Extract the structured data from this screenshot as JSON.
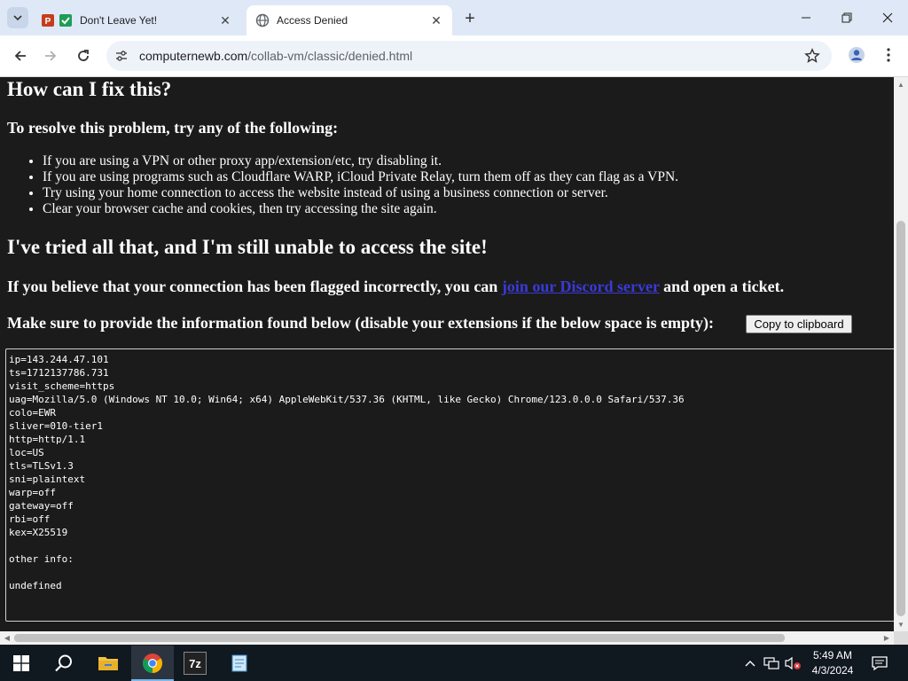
{
  "tabs": [
    {
      "title": "Don't Leave Yet!",
      "close": "✕"
    },
    {
      "title": "Access Denied",
      "close": "✕"
    }
  ],
  "new_tab": "+",
  "window_controls": {
    "minimize": "—",
    "maximize": "❐",
    "close": "✕"
  },
  "omnibox": {
    "host": "computernewb.com",
    "path": "/collab-vm/classic/denied.html"
  },
  "page": {
    "heading_fix": "How can I fix this?",
    "subheading_resolve": "To resolve this problem, try any of the following:",
    "fix_items": [
      "If you are using a VPN or other proxy app/extension/etc, try disabling it.",
      "If you are using programs such as Cloudflare WARP, iCloud Private Relay, turn them off as they can flag as a VPN.",
      "Try using your home connection to access the website instead of using a business connection or server.",
      "Clear your browser cache and cookies, then try accessing the site again."
    ],
    "heading_still": "I've tried all that, and I'm still unable to access the site!",
    "flagged_text_before": "If you believe that your connection has been flagged incorrectly, you can ",
    "flagged_link": "join our Discord server",
    "flagged_text_after": " and open a ticket.",
    "provide_info": "Make sure to provide the information found below (disable your extensions if the below space is empty):",
    "copy_button": "Copy to clipboard",
    "info_text": "ip=143.244.47.101\nts=1712137786.731\nvisit_scheme=https\nuag=Mozilla/5.0 (Windows NT 10.0; Win64; x64) AppleWebKit/537.36 (KHTML, like Gecko) Chrome/123.0.0.0 Safari/537.36\ncolo=EWR\nsliver=010-tier1\nhttp=http/1.1\nloc=US\ntls=TLSv1.3\nsni=plaintext\nwarp=off\ngateway=off\nrbi=off\nkex=X25519\n\nother info:\n\nundefined"
  },
  "taskbar": {
    "time": "5:49 AM",
    "date": "4/3/2024",
    "zip_label": "7z"
  },
  "colors": {
    "page_bg": "#1b1b1b",
    "link": "#3a3ad8",
    "tabstrip": "#dfe8f6",
    "taskbar": "#101820"
  }
}
